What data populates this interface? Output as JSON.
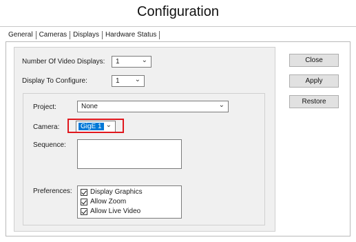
{
  "window": {
    "title": "Configuration"
  },
  "tabs": [
    {
      "label": "General"
    },
    {
      "label": "Cameras"
    },
    {
      "label": "Displays"
    },
    {
      "label": "Hardware Status"
    }
  ],
  "buttons": {
    "close": "Close",
    "apply": "Apply",
    "restore": "Restore"
  },
  "displays": {
    "num_label": "Number Of Video Displays:",
    "num_value": "1",
    "configure_label": "Display To Configure:",
    "configure_value": "1"
  },
  "display_settings": {
    "project_label": "Project:",
    "project_value": "None",
    "camera_label": "Camera:",
    "camera_value": "GigE 1",
    "sequence_label": "Sequence:",
    "preferences_label": "Preferences:",
    "preferences": [
      {
        "label": "Display Graphics",
        "checked": true
      },
      {
        "label": "Allow Zoom",
        "checked": true
      },
      {
        "label": "Allow Live Video",
        "checked": true
      }
    ]
  },
  "icons": {
    "dropdown": "chevron-down-icon",
    "check": "checkmark-icon"
  },
  "colors": {
    "selection": "#0078d7",
    "highlight_box": "#e0161c"
  }
}
